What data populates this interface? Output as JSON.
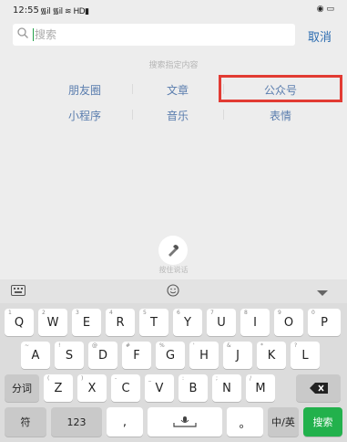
{
  "status": {
    "time": "12:55",
    "signal": "᯾il ᯾il ≋ HD▮",
    "battery": "◉ ▭"
  },
  "search": {
    "placeholder": "搜索",
    "cancel_label": "取消"
  },
  "hint": "搜索指定内容",
  "categories": {
    "row1": [
      "朋友圈",
      "文章",
      "公众号"
    ],
    "row2": [
      "小程序",
      "音乐",
      "表情"
    ]
  },
  "voice_label": "按住说话",
  "keyboard": {
    "row1": [
      {
        "k": "Q",
        "s": "1"
      },
      {
        "k": "W",
        "s": "2"
      },
      {
        "k": "E",
        "s": "3"
      },
      {
        "k": "R",
        "s": "4"
      },
      {
        "k": "T",
        "s": "5"
      },
      {
        "k": "Y",
        "s": "6"
      },
      {
        "k": "U",
        "s": "7"
      },
      {
        "k": "I",
        "s": "8"
      },
      {
        "k": "O",
        "s": "9"
      },
      {
        "k": "P",
        "s": "0"
      }
    ],
    "row2": [
      {
        "k": "A",
        "s": "~"
      },
      {
        "k": "S",
        "s": "!"
      },
      {
        "k": "D",
        "s": "@"
      },
      {
        "k": "F",
        "s": "#"
      },
      {
        "k": "G",
        "s": "%"
      },
      {
        "k": "H",
        "s": "'"
      },
      {
        "k": "J",
        "s": "&"
      },
      {
        "k": "K",
        "s": "*"
      },
      {
        "k": "L",
        "s": "?"
      }
    ],
    "row3_left": "分词",
    "row3": [
      {
        "k": "Z",
        "s": "("
      },
      {
        "k": "X",
        "s": ")"
      },
      {
        "k": "C",
        "s": "-"
      },
      {
        "k": "V",
        "s": "_"
      },
      {
        "k": "B",
        "s": ":"
      },
      {
        "k": "N",
        "s": ";"
      },
      {
        "k": "M",
        "s": "/"
      }
    ],
    "row4": {
      "symbol": "符",
      "num": "123",
      "comma": ",",
      "period": "。",
      "lang": "中/英",
      "search": "搜索"
    }
  },
  "colors": {
    "accent_green": "#22b14c",
    "link_blue": "#5a7dae",
    "highlight_red": "#e23b33"
  }
}
